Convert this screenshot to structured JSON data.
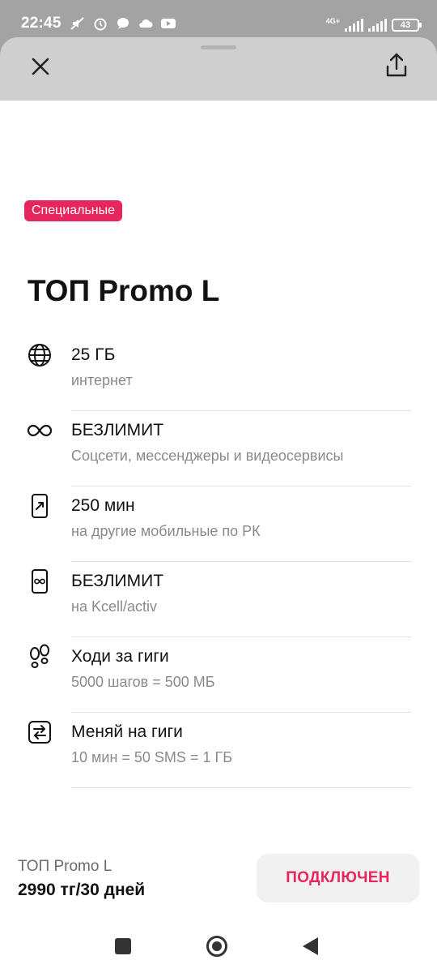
{
  "status_bar": {
    "time": "22:45",
    "network": "4G+",
    "battery": "43"
  },
  "sheet": {
    "close_icon": "close-icon",
    "share_icon": "share-icon"
  },
  "badge": "Специальные",
  "plan_title": "ТОП Promo L",
  "features": [
    {
      "icon": "globe-icon",
      "title": "25 ГБ",
      "subtitle": "интернет"
    },
    {
      "icon": "infinity-icon",
      "title": "БЕЗЛИМИТ",
      "subtitle": "Соцсети, мессенджеры и видеосервисы"
    },
    {
      "icon": "phone-outgoing-icon",
      "title": "250 мин",
      "subtitle": "на другие мобильные по РК"
    },
    {
      "icon": "phone-unlimited-icon",
      "title": "БЕЗЛИМИТ",
      "subtitle": "на Kcell/activ"
    },
    {
      "icon": "footprints-icon",
      "title": "Ходи за гиги",
      "subtitle": "5000 шагов = 500 МБ"
    },
    {
      "icon": "exchange-icon",
      "title": "Меняй на гиги",
      "subtitle": "10 мин = 50 SMS = 1 ГБ"
    }
  ],
  "bottom_bar": {
    "plan_name": "ТОП Promo L",
    "price": "2990 тг/30 дней",
    "connect_label": "ПОДКЛЮЧЕН"
  },
  "colors": {
    "accent": "#e8265e"
  }
}
